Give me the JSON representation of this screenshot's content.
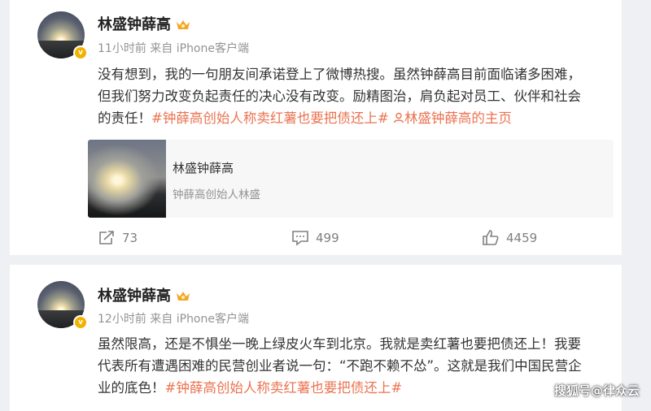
{
  "posts": [
    {
      "author": "林盛钟薛高",
      "verified_mark": "v",
      "time": "11小时前",
      "source": "来自 iPhone客户端",
      "lines": [
        "没有想到，我的一句朋友间承诺登上了微博热搜。虽然钟薛高目前面临诸多困难，",
        "但我们努力改变负起责任的决心没有改变。励精图治，肩负起对员工、伙伴和社会",
        "的责任！"
      ],
      "hashtag": "#钟薛高创始人称卖红薯也要把债还上#",
      "user_link": "林盛钟薛高的主页",
      "card": {
        "title": "林盛钟薛高",
        "subtitle": "钟薛高创始人林盛"
      },
      "actions": {
        "reposts": "73",
        "comments": "499",
        "likes": "4459"
      }
    },
    {
      "author": "林盛钟薛高",
      "verified_mark": "v",
      "time": "12小时前",
      "source": "来自 iPhone客户端",
      "lines": [
        "虽然限高，还是不惧坐一晚上绿皮火车到北京。我就是卖红薯也要把债还上！我要",
        "代表所有遭遇困难的民营创业者说一句：“不跑不赖不怂”。这就是我们中国民营企",
        "业的底色！"
      ],
      "hashtag": "#钟薛高创始人称卖红薯也要把债还上#"
    }
  ],
  "watermark": "搜狐号@律众云",
  "colors": {
    "accent": "#eb7350",
    "meta": "#939393",
    "badge": "#f0b400"
  }
}
